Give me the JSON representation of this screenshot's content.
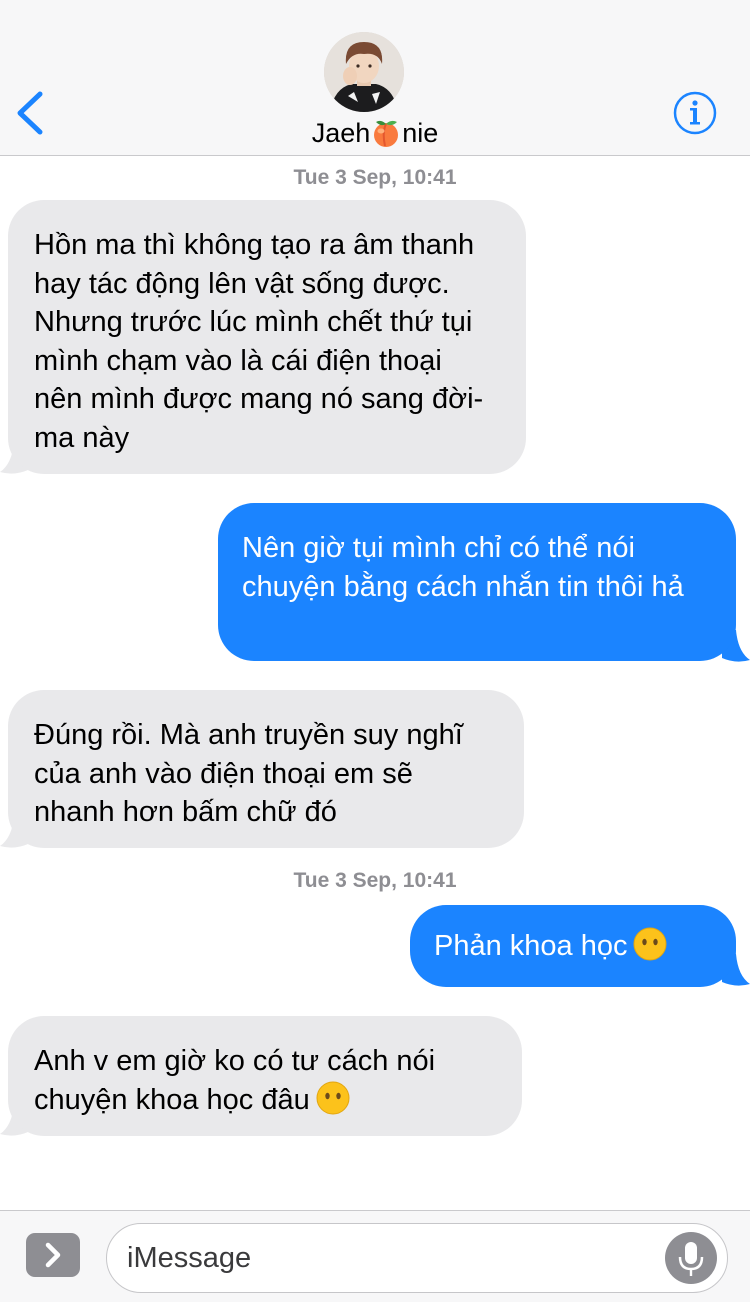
{
  "header": {
    "contact_name_prefix": "Jaeh",
    "contact_name_suffix": "nie",
    "back_icon": "chevron-left-icon",
    "info_icon": "info-icon",
    "accent_color": "#1b84ff"
  },
  "conversation": {
    "timestamps": [
      "Tue 3 Sep, 10:41",
      "Tue 3 Sep, 10:41"
    ],
    "messages": [
      {
        "direction": "incoming",
        "text": "Hồn ma thì không tạo ra âm thanh hay tác động lên vật sống được. Nhưng trước lúc mình chết thứ tụi mình chạm vào là cái điện thoại nên mình được mang nó sang đời-ma này"
      },
      {
        "direction": "outgoing",
        "text": "Nên giờ tụi mình chỉ có thể nói chuyện bằng cách nhắn tin thôi hả"
      },
      {
        "direction": "incoming",
        "text": "Đúng rồi. Mà anh truyền suy nghĩ của anh vào điện thoại em sẽ nhanh hơn bấm chữ đó"
      },
      {
        "direction": "outgoing",
        "text": "Phản khoa học"
      },
      {
        "direction": "incoming",
        "text": "Anh v em giờ ko có tư cách nói chuyện khoa học đâu"
      }
    ]
  },
  "compose": {
    "placeholder": "iMessage",
    "value": "",
    "apps_icon": "chevron-right-icon",
    "mic_icon": "microphone-icon"
  },
  "colors": {
    "incoming_bubble": "#e9e9eb",
    "outgoing_bubble": "#1b84ff",
    "timestamp": "#8e8e93"
  }
}
